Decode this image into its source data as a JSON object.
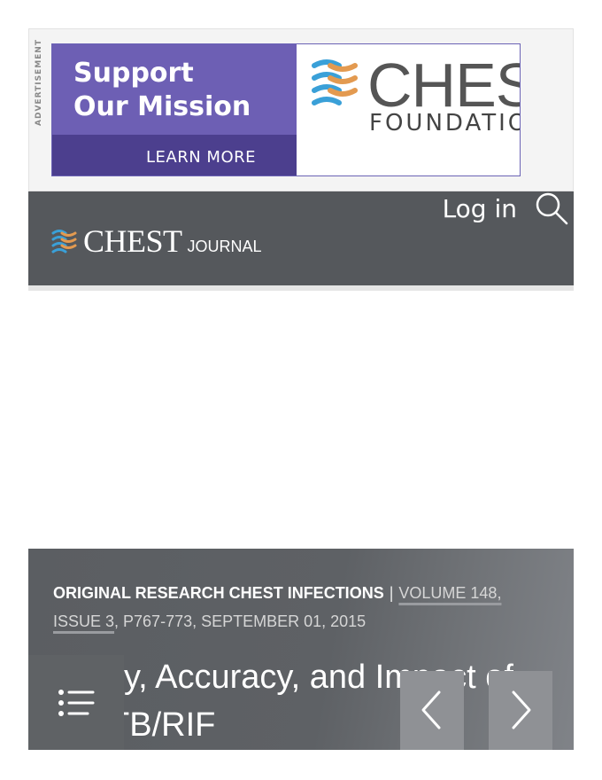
{
  "advertisement": {
    "label": "ADVERTISEMENT",
    "headline_line1": "Support",
    "headline_line2": "Our Mission",
    "cta": "LEARN MORE",
    "brand": "CHEST",
    "brand_sub": "FOUNDATION"
  },
  "header": {
    "login_label": "Log in",
    "search_icon": "search-icon",
    "logo_text": "CHEST",
    "logo_sub": "JOURNAL"
  },
  "article": {
    "category": "ORIGINAL RESEARCH CHEST INFECTIONS",
    "separator": "|",
    "issue_link": "VOLUME 148, ISSUE 3",
    "pages_date": ", P767-773, SEPTEMBER 01, 2015",
    "title": "Feasibility, Accuracy, and Impact of Xpert MTB/RIF"
  },
  "controls": {
    "toc_icon": "list-icon",
    "prev_icon": "chevron-left-icon",
    "next_icon": "chevron-right-icon"
  },
  "colors": {
    "header_bg": "#55585c",
    "ad_purple": "#6d5fb4",
    "ad_purple_dark": "#4c3f8e",
    "logo_blue": "#3aa0d8",
    "logo_orange": "#e39a50"
  }
}
